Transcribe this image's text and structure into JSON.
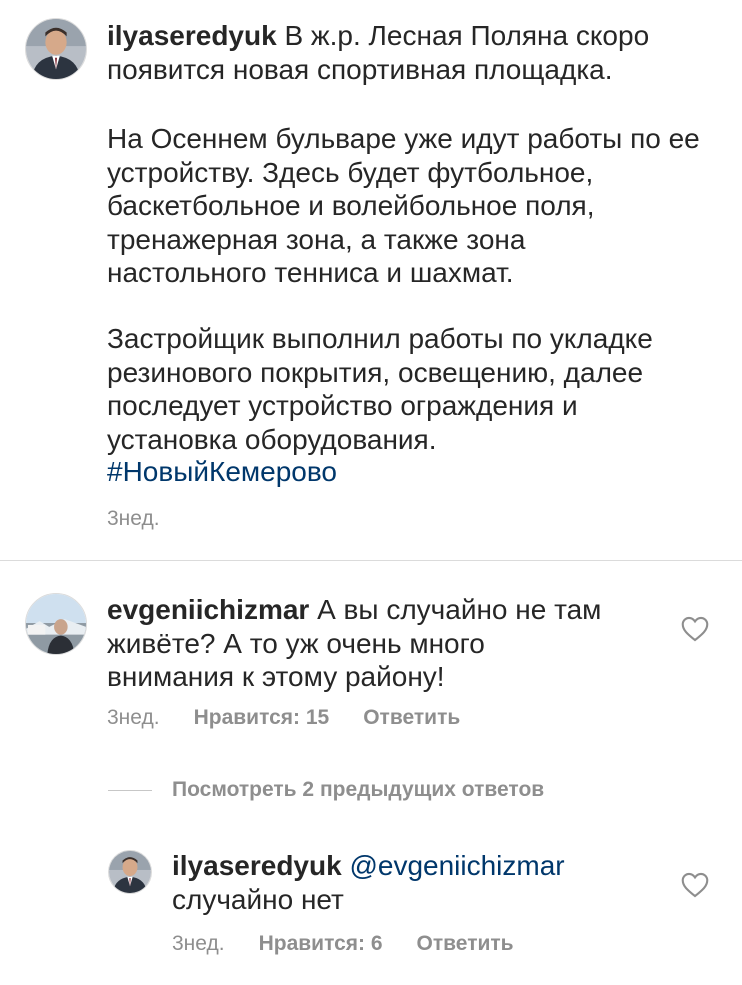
{
  "post": {
    "username": "ilyaseredyuk",
    "caption_lead": " В ж.р. Лесная Поляна скоро\nпоявится новая спортивная площадка.",
    "paragraph_2": "На Осеннем бульваре уже идут работы по ее\nустройству. Здесь будет футбольное,\nбаскетбольное и волейбольное поля,\nтренажерная зона, а также зона\nнастольного тенниса и шахмат.",
    "paragraph_3": "Застройщик выполнил работы по укладке\nрезинового покрытия, освещению, далее\nпоследует устройство ограждения и\nустановка оборудования.",
    "hashtag": "#НовыйКемерово",
    "time": "3нед."
  },
  "comment": {
    "username": "evgeniichizmar",
    "text": " А вы случайно не там\nживёте? А то уж очень много\nвнимания к этому району!",
    "time": "3нед.",
    "likes": "Нравится: 15",
    "reply_label": "Ответить"
  },
  "view_previous_replies": "Посмотреть 2 предыдущих ответов",
  "reply": {
    "username": "ilyaseredyuk",
    "mention": " @evgeniichizmar",
    "text": "случайно нет",
    "time": "3нед.",
    "likes": "Нравится: 6",
    "reply_label": "Ответить"
  }
}
